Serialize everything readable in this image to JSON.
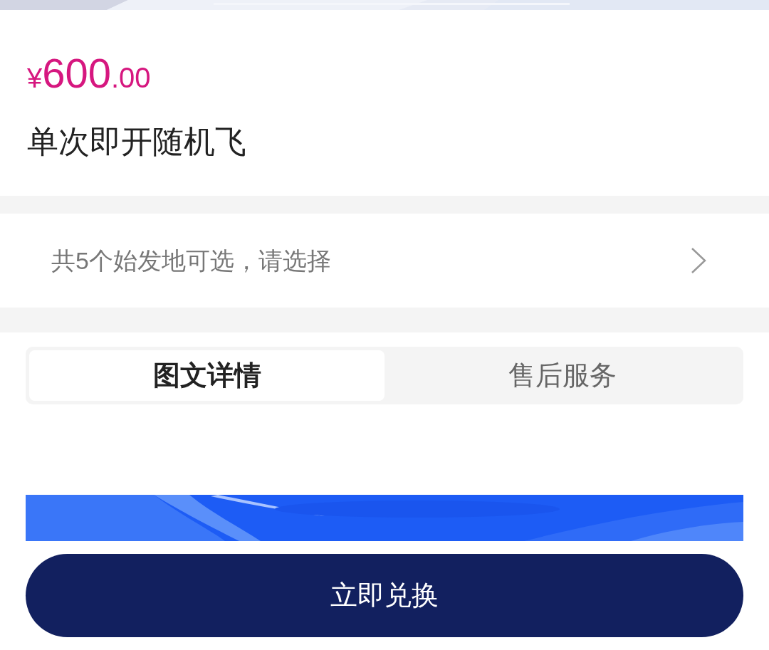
{
  "product": {
    "currency": "¥",
    "price_integer": "600",
    "price_decimal": ".00",
    "title": "单次即开随机飞"
  },
  "origin_selector": {
    "text": "共5个始发地可选，请选择"
  },
  "tabs": [
    {
      "label": "图文详情",
      "selected": true
    },
    {
      "label": "售后服务",
      "selected": false
    }
  ],
  "action_button": {
    "label": "立即兑换"
  }
}
